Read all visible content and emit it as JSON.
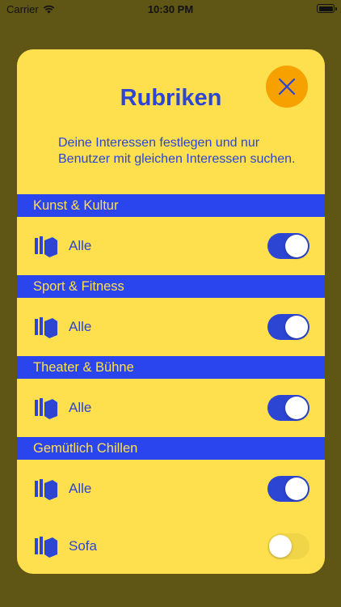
{
  "status_bar": {
    "carrier": "Carrier",
    "time": "10:30 PM"
  },
  "modal": {
    "title": "Rubriken",
    "description": "Deine Interessen festlegen und nur Benutzer mit gleichen Interessen suchen.",
    "close_icon": "close-x-icon"
  },
  "colors": {
    "card_background": "#fee04f",
    "accent_blue": "#2c45d2",
    "header_blue": "#2b45ee",
    "close_orange": "#f7a100",
    "backdrop": "#5f5616"
  },
  "sections": [
    {
      "title": "Kunst & Kultur",
      "rows": [
        {
          "label": "Alle",
          "icon": "books-icon",
          "on": true
        }
      ]
    },
    {
      "title": "Sport & Fitness",
      "rows": [
        {
          "label": "Alle",
          "icon": "books-icon",
          "on": true
        }
      ]
    },
    {
      "title": "Theater & Bühne",
      "rows": [
        {
          "label": "Alle",
          "icon": "books-icon",
          "on": true
        }
      ]
    },
    {
      "title": "Gemütlich Chillen",
      "rows": [
        {
          "label": "Alle",
          "icon": "books-icon",
          "on": true
        },
        {
          "label": "Sofa",
          "icon": "books-icon",
          "on": false
        }
      ]
    }
  ]
}
